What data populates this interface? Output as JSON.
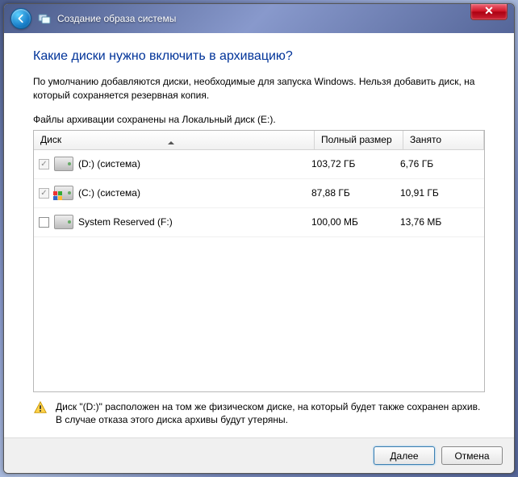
{
  "window": {
    "close_glyph": "✕",
    "back_tooltip": "Назад",
    "title": "Создание образа системы"
  },
  "main": {
    "heading": "Какие диски нужно включить в архивацию?",
    "description": "По умолчанию добавляются диски, необходимые для запуска Windows. Нельзя добавить диск, на который сохраняется резервная копия.",
    "location_line": "Файлы архивации сохранены на Локальный диск (E:)."
  },
  "table": {
    "columns": {
      "disk": "Диск",
      "size": "Полный размер",
      "used": "Занято"
    },
    "rows": [
      {
        "checked": true,
        "disabled": true,
        "overlay": null,
        "name": "(D:) (система)",
        "size": "103,72 ГБ",
        "used": "6,76 ГБ"
      },
      {
        "checked": true,
        "disabled": true,
        "overlay": "windows",
        "name": "(C:) (система)",
        "size": "87,88 ГБ",
        "used": "10,91 ГБ"
      },
      {
        "checked": false,
        "disabled": false,
        "overlay": null,
        "name": "System Reserved (F:)",
        "size": "100,00 МБ",
        "used": "13,76 МБ"
      }
    ]
  },
  "warning": {
    "text": "Диск \"(D:)\" расположен на том же физическом диске, на который будет также сохранен архив. В случае отказа этого диска архивы будут утеряны."
  },
  "footer": {
    "next": "Далее",
    "cancel": "Отмена"
  }
}
